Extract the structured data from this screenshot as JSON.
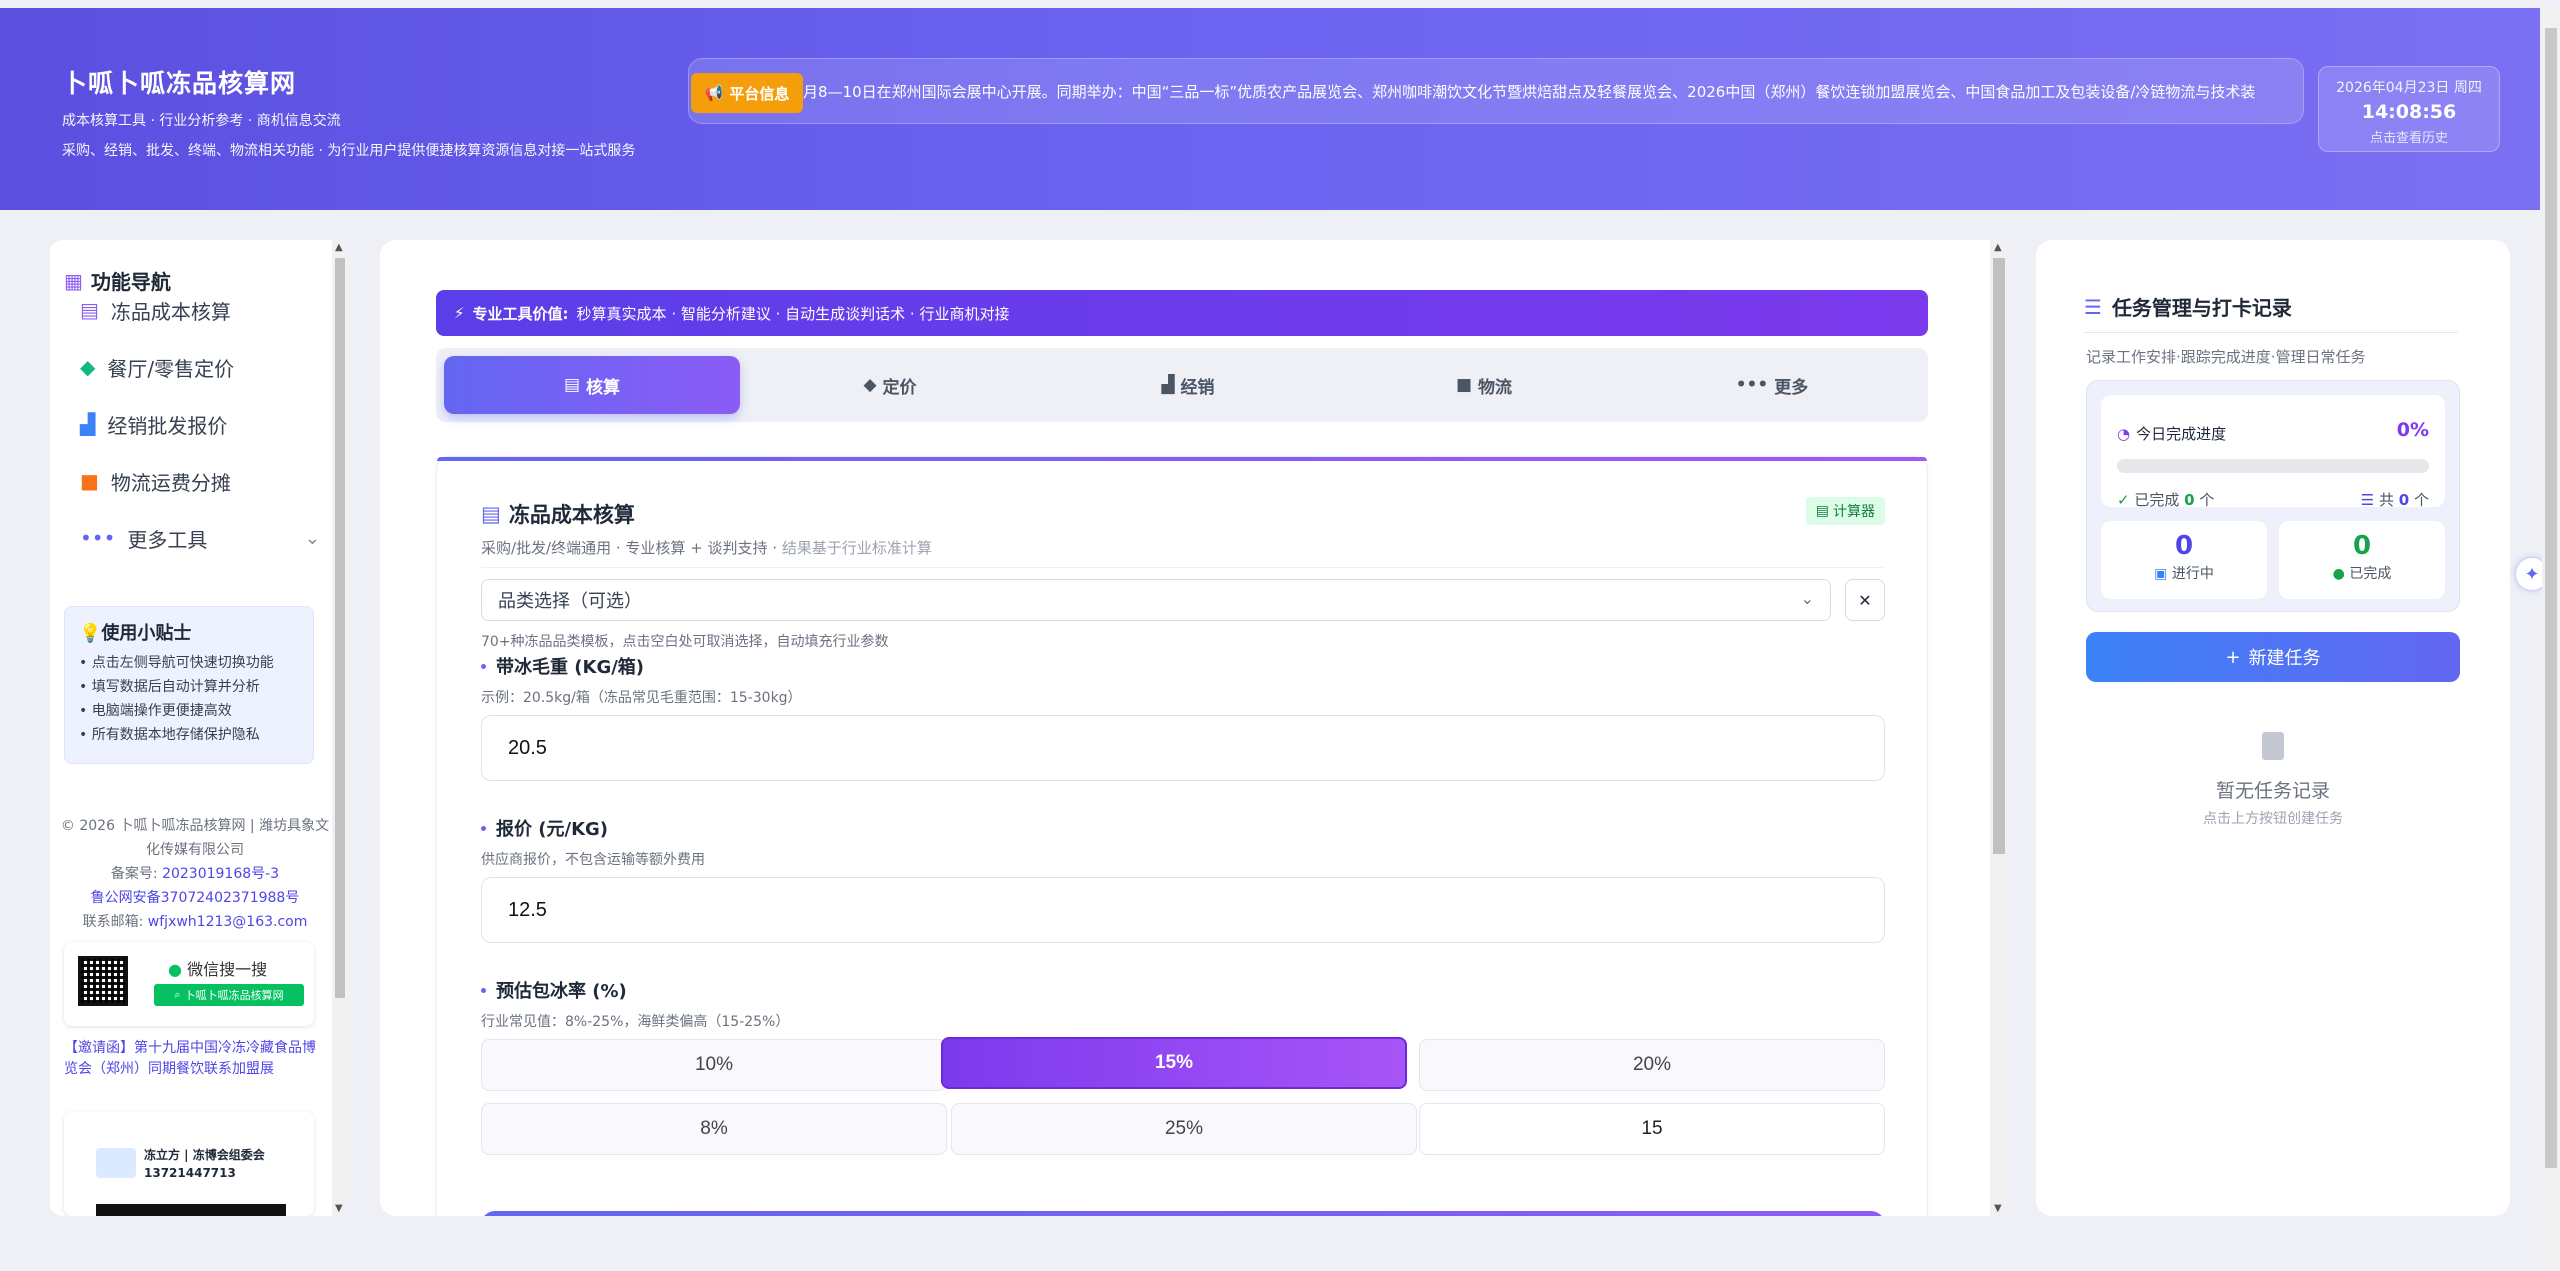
{
  "header": {
    "title": "卜呱卜呱冻品核算网",
    "subtitle": "成本核算工具 · 行业分析参考 · 商机信息交流",
    "description": "采购、经销、批发、终端、物流相关功能 · 为行业用户提供便捷核算资源信息对接一站式服务",
    "ticker_badge": "平台信息",
    "ticker_text": "月8—10日在郑州国际会展中心开展。同期举办：中国“三品一标”优质农产品展览会、郑州咖啡潮饮文化节暨烘焙甜点及轻餐展览会、2026中国（郑州）餐饮连锁加盟展览会、中国食品加工及包装设备/冷链物流与技术装",
    "date": "2026年04月23日 周四",
    "time": "14:08:56",
    "history_link": "点击查看历史"
  },
  "sidebar": {
    "title": "功能导航",
    "items": [
      {
        "label": "冻品成本核算",
        "icon": "calculator-icon",
        "color": "#8b5cf6"
      },
      {
        "label": "餐厅/零售定价",
        "icon": "tag-icon",
        "color": "#10b981"
      },
      {
        "label": "经销批发报价",
        "icon": "boxes-icon",
        "color": "#3b82f6"
      },
      {
        "label": "物流运费分摊",
        "icon": "truck-icon",
        "color": "#f97316"
      },
      {
        "label": "更多工具",
        "icon": "ellipsis-icon",
        "color": "#6366f1"
      }
    ],
    "tips_title": "使用小贴士",
    "tips": [
      "• 点击左侧导航可快速切换功能",
      "• 填写数据后自动计算并分析",
      "• 电脑端操作更便捷高效",
      "• 所有数据本地存储保护隐私"
    ],
    "copyright": "© 2026 卜呱卜呱冻品核算网 | 潍坊具象文化传媒有限公司",
    "icp_label": "备案号:",
    "icp_value": "2023019168号-3",
    "police": "鲁公网安备37072402371988号",
    "email_label": "联系邮箱:",
    "email_value": "wfjxwh1213@163.com",
    "wechat_label": "微信搜一搜",
    "wechat_search": "卜呱卜呱冻品核算网",
    "invite_text": "【邀请函】第十九届中国冷冻冷藏食品博览会（郑州）同期餐饮联系加盟展",
    "sponsor_line1": "冻立方 | 冻博会组委会",
    "sponsor_line2": "13721447713"
  },
  "main": {
    "banner_strong": "专业工具价值:",
    "banner_text": "秒算真实成本 · 智能分析建议 · 自动生成谈判话术 · 行业商机对接",
    "tabs": [
      {
        "label": "核算",
        "icon": "calculator-icon"
      },
      {
        "label": "定价",
        "icon": "tag-icon"
      },
      {
        "label": "经销",
        "icon": "boxes-icon"
      },
      {
        "label": "物流",
        "icon": "truck-icon"
      },
      {
        "label": "更多",
        "icon": "ellipsis-icon"
      }
    ],
    "active_tab": 0,
    "card_title": "冻品成本核算",
    "card_badge": "计算器",
    "card_subtitle": "采购/批发/终端通用 · 专业核算 + 谈判支持 · ",
    "card_subtitle_muted": "结果基于行业标准计算",
    "select_placeholder": "品类选择（可选）",
    "select_hint": "70+种冻品品类模板，点击空白处可取消选择，自动填充行业参数",
    "weight_label": "带冰毛重 (KG/箱)",
    "weight_hint": "示例：20.5kg/箱（冻品常见毛重范围：15-30kg）",
    "weight_value": "20.5",
    "price_label": "报价 (元/KG)",
    "price_hint": "供应商报价，不包含运输等额外费用",
    "price_value": "12.5",
    "ice_label": "预估包冰率 (%)",
    "ice_hint": "行业常见值：8%-25%，海鲜类偏高（15-25%）",
    "ice_options": [
      "10%",
      "15%",
      "20%",
      "8%",
      "25%"
    ],
    "ice_custom": "15",
    "ice_selected": "15%"
  },
  "right": {
    "title": "任务管理与打卡记录",
    "subtitle": "记录工作安排·跟踪完成进度·管理日常任务",
    "progress_label": "今日完成进度",
    "progress_pct": "0%",
    "progress_fraction": 0,
    "done_prefix": "已完成 ",
    "done_count": "0",
    "done_suffix": " 个",
    "total_prefix": "共 ",
    "total_count": "0",
    "total_suffix": " 个",
    "ongoing_num": "0",
    "ongoing_label": "进行中",
    "completed_num": "0",
    "completed_label": "已完成",
    "new_task": "新建任务",
    "empty_title": "暂无任务记录",
    "empty_sub": "点击上方按钮创建任务"
  }
}
